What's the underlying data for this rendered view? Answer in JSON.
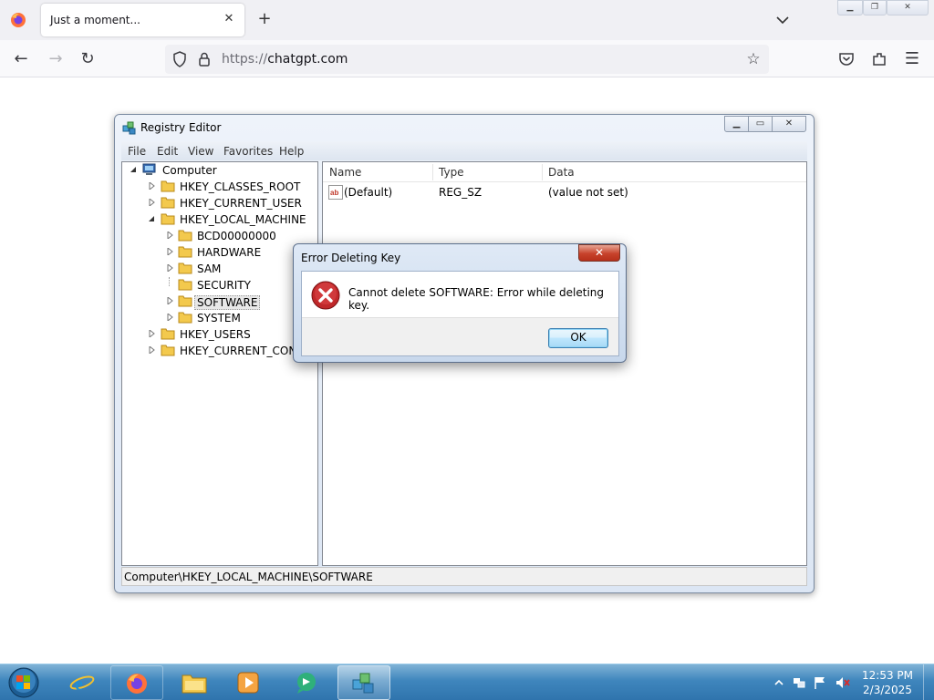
{
  "browser": {
    "tab_title": "Just a moment...",
    "url_protocol": "https://",
    "url_host": "chatgpt.com",
    "icons": [
      "firefox-logo",
      "close-icon",
      "plus-icon",
      "chevron-down-icon",
      "back-icon",
      "forward-icon",
      "reload-icon",
      "shield-icon",
      "lock-icon",
      "star-icon",
      "pocket-icon",
      "extensions-icon",
      "menu-icon"
    ]
  },
  "regedit": {
    "title": "Registry Editor",
    "menu": [
      "File",
      "Edit",
      "View",
      "Favorites",
      "Help"
    ],
    "tree": {
      "root": "Computer",
      "hives": [
        {
          "label": "HKEY_CLASSES_ROOT",
          "expanded": false
        },
        {
          "label": "HKEY_CURRENT_USER",
          "expanded": false
        },
        {
          "label": "HKEY_LOCAL_MACHINE",
          "expanded": true,
          "children": [
            {
              "label": "BCD00000000",
              "expandable": true
            },
            {
              "label": "HARDWARE",
              "expandable": true
            },
            {
              "label": "SAM",
              "expandable": true
            },
            {
              "label": "SECURITY",
              "expandable": false
            },
            {
              "label": "SOFTWARE",
              "expandable": true,
              "selected": true
            },
            {
              "label": "SYSTEM",
              "expandable": true
            }
          ]
        },
        {
          "label": "HKEY_USERS",
          "expanded": false
        },
        {
          "label": "HKEY_CURRENT_CONF",
          "expanded": false
        }
      ]
    },
    "columns": [
      "Name",
      "Type",
      "Data"
    ],
    "values": [
      {
        "name": "(Default)",
        "type": "REG_SZ",
        "data": "(value not set)"
      }
    ],
    "status": "Computer\\HKEY_LOCAL_MACHINE\\SOFTWARE"
  },
  "dialog": {
    "title": "Error Deleting Key",
    "message": "Cannot delete SOFTWARE:  Error while deleting key.",
    "ok_label": "OK",
    "close_glyph": "✕"
  },
  "taskbar": {
    "time": "12:53 PM",
    "date": "2/3/2025",
    "apps": [
      "internet-explorer",
      "firefox",
      "file-explorer",
      "media-player",
      "chat-app",
      "registry-editor"
    ],
    "active_app": "registry-editor",
    "accent": "#3f86bd"
  }
}
